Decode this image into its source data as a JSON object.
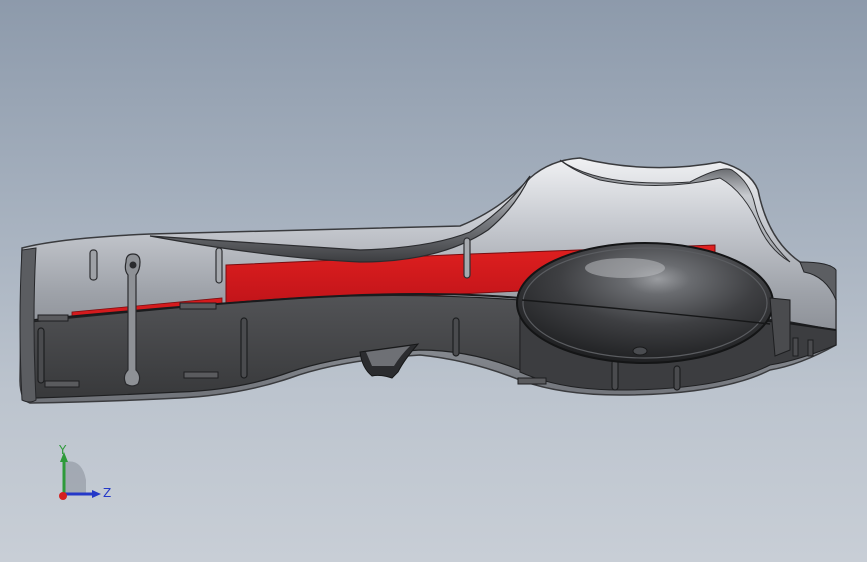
{
  "triad": {
    "y_label": "Y",
    "z_label": "Z"
  },
  "colors": {
    "background_top": "#8d9aab",
    "background_bottom": "#c8ced6",
    "shell_light": "#d2d5da",
    "shell_dark": "#3e3e40",
    "accent_red": "#d8181c",
    "axis_y": "#2e9a3a",
    "axis_z": "#2438c8",
    "axis_x": "#d42020"
  },
  "icons": {
    "triad": "coordinate-triad-icon"
  }
}
